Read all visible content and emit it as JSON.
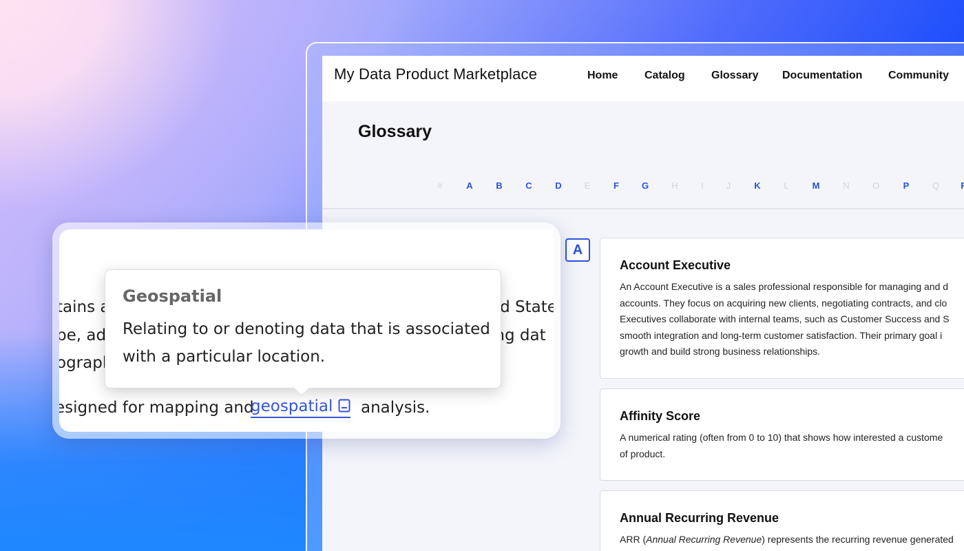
{
  "header": {
    "brand": "My Data Product Marketplace",
    "nav": [
      {
        "label": "Home"
      },
      {
        "label": "Catalog"
      },
      {
        "label": "Glossary"
      },
      {
        "label": "Documentation"
      },
      {
        "label": "Community"
      }
    ]
  },
  "page": {
    "title": "Glossary",
    "alphabet": [
      {
        "letter": "#",
        "active": false
      },
      {
        "letter": "A",
        "active": true
      },
      {
        "letter": "B",
        "active": true
      },
      {
        "letter": "C",
        "active": true
      },
      {
        "letter": "D",
        "active": true
      },
      {
        "letter": "E",
        "active": false
      },
      {
        "letter": "F",
        "active": true
      },
      {
        "letter": "G",
        "active": true
      },
      {
        "letter": "H",
        "active": false
      },
      {
        "letter": "I",
        "active": false
      },
      {
        "letter": "J",
        "active": false
      },
      {
        "letter": "K",
        "active": true
      },
      {
        "letter": "L",
        "active": false
      },
      {
        "letter": "M",
        "active": true
      },
      {
        "letter": "N",
        "active": false
      },
      {
        "letter": "O",
        "active": false
      },
      {
        "letter": "P",
        "active": true
      },
      {
        "letter": "Q",
        "active": false
      },
      {
        "letter": "R",
        "active": true
      }
    ],
    "section_letter": "A",
    "terms": [
      {
        "title": "Account Executive",
        "lines": [
          "An Account Executive is a sales professional responsible for managing and d",
          "accounts. They focus on acquiring new clients, negotiating contracts, and clo",
          "Executives collaborate with internal teams, such as Customer Success and S",
          "smooth integration and long-term customer satisfaction. Their primary goal i",
          "growth and build strong business relationships."
        ]
      },
      {
        "title": "Affinity Score",
        "lines": [
          "A numerical rating (often from 0 to 10) that shows how interested a custome",
          "of product."
        ]
      },
      {
        "title": "Annual Recurring Revenue",
        "line_prefix": "ARR (",
        "line_italic": "Annual Recurring Revenue",
        "line_suffix": ") represents the recurring revenue generated"
      }
    ]
  },
  "zoom": {
    "bg_lines": [
      {
        "left": "tains a",
        "right": "ed State"
      },
      {
        "left": "pe, ad",
        "right": "ing dat"
      },
      {
        "left": "ographi",
        "right": ""
      }
    ],
    "sentence_before": "esigned for mapping and",
    "link_text": "geospatial",
    "sentence_after": "analysis.",
    "tooltip": {
      "title": "Geospatial",
      "body": "Relating to or denoting data that is associated with a particular location."
    }
  },
  "colors": {
    "accent": "#2a52e0",
    "link": "#3355d8",
    "disabled_letter": "#d2d4dc"
  }
}
